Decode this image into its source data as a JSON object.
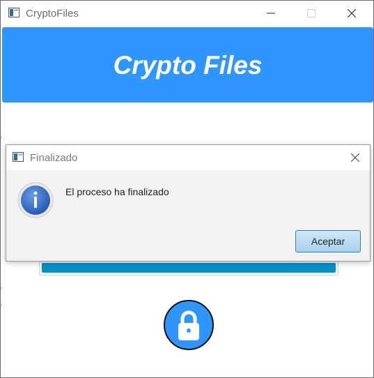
{
  "window": {
    "title": "CryptoFiles"
  },
  "banner": {
    "title": "Crypto Files"
  },
  "progress": {
    "fraction": 1.0
  },
  "dialog": {
    "title": "Finalizado",
    "message": "El proceso ha finalizado",
    "accept_label": "Aceptar"
  },
  "icons": {
    "app": "app-window-icon",
    "minimize": "minimize-icon",
    "maximize": "maximize-icon",
    "close": "close-icon",
    "info": "info-icon",
    "lock": "lock-icon"
  },
  "colors": {
    "accent": "#2f96ff",
    "progress": "#0391c8",
    "button_border": "#2f7fb6"
  }
}
